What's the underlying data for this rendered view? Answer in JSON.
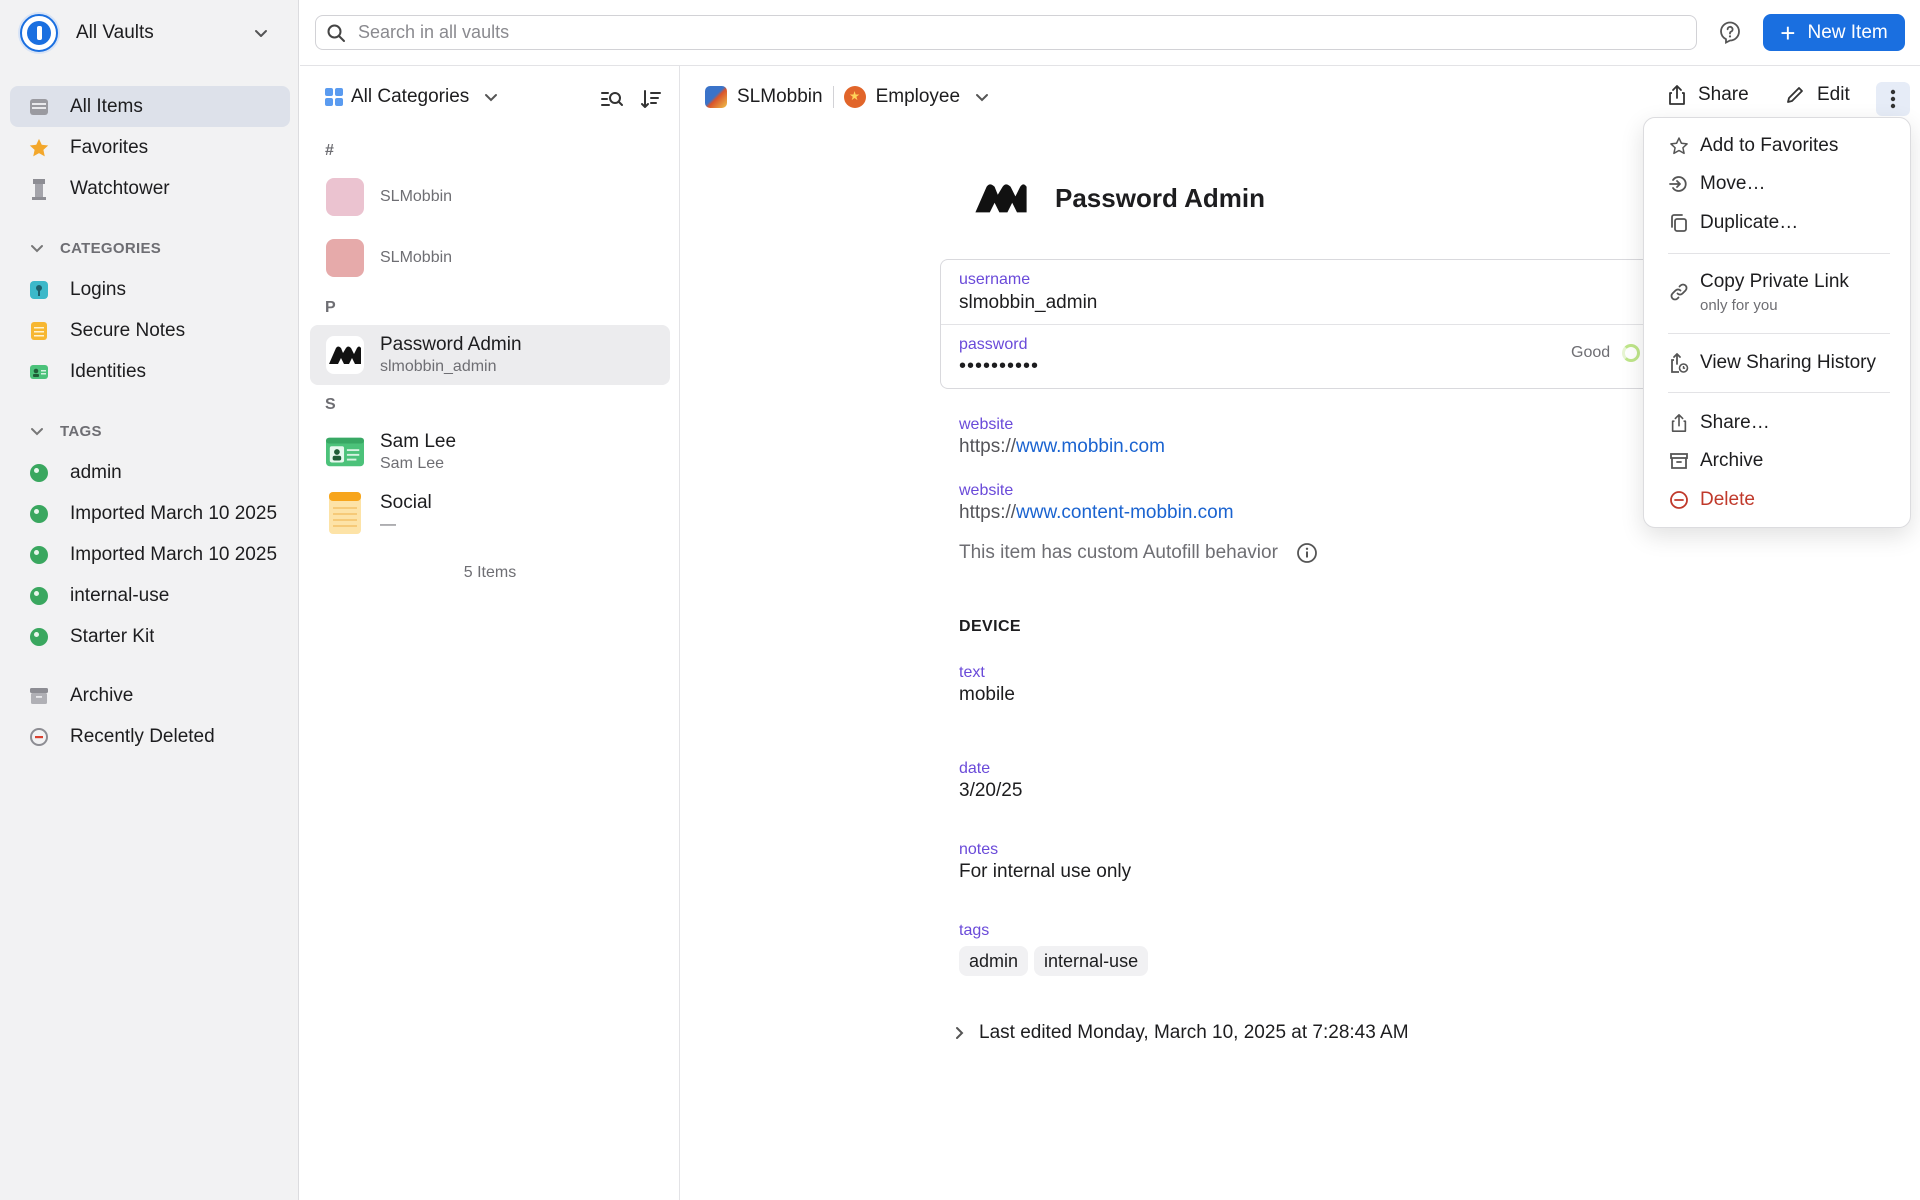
{
  "sidebar": {
    "vault_name": "All Vaults",
    "items": [
      {
        "label": "All Items",
        "icon": "all-items-icon"
      },
      {
        "label": "Favorites",
        "icon": "star-icon"
      },
      {
        "label": "Watchtower",
        "icon": "watchtower-icon"
      }
    ],
    "categories_header": "CATEGORIES",
    "categories": [
      {
        "label": "Logins",
        "icon": "login-icon"
      },
      {
        "label": "Secure Notes",
        "icon": "note-icon"
      },
      {
        "label": "Identities",
        "icon": "identity-icon"
      }
    ],
    "tags_header": "TAGS",
    "tags": [
      {
        "label": "admin"
      },
      {
        "label": "Imported March 10 2025"
      },
      {
        "label": "Imported March 10 2025"
      },
      {
        "label": "internal-use"
      },
      {
        "label": "Starter Kit"
      }
    ],
    "archive": "Archive",
    "recently_deleted": "Recently Deleted"
  },
  "topbar": {
    "search_placeholder": "Search in all vaults",
    "new_item_label": "New Item"
  },
  "list": {
    "category_label": "All Categories",
    "groups": [
      {
        "letter": "#"
      },
      {
        "letter": "P"
      },
      {
        "letter": "S"
      }
    ],
    "items": [
      {
        "title": "SLMobbin",
        "subtitle": "",
        "color": "#ebc3d0"
      },
      {
        "title": "SLMobbin",
        "subtitle": "",
        "color": "#e6aaaa"
      },
      {
        "title": "Password Admin",
        "subtitle": "slmobbin_admin"
      },
      {
        "title": "Sam Lee",
        "subtitle": "Sam Lee"
      },
      {
        "title": "Social",
        "subtitle": "—"
      }
    ],
    "count": "5 Items"
  },
  "detail": {
    "vault": "SLMobbin",
    "owner": "Employee",
    "share_label": "Share",
    "edit_label": "Edit",
    "title": "Password Admin",
    "username_label": "username",
    "username_value": "slmobbin_admin",
    "password_label": "password",
    "password_value": "••••••••••",
    "strength": "Good",
    "website1_label": "website",
    "website1_prefix": "https://",
    "website1_link": "www.mobbin.com",
    "website2_label": "website",
    "website2_prefix": "https://",
    "website2_link": "www.content-mobbin.com",
    "autofill_note": "This item has custom Autofill behavior",
    "section_title": "DEVICE",
    "text_label": "text",
    "text_value": "mobile",
    "date_label": "date",
    "date_value": "3/20/25",
    "notes_label": "notes",
    "notes_value": "For internal use only",
    "tags_label": "tags",
    "tags": [
      "admin",
      "internal-use"
    ],
    "last_edited": "Last edited Monday, March 10, 2025 at 7:28:43 AM"
  },
  "menu": {
    "items": [
      {
        "label": "Add to Favorites",
        "icon": "star-outline-icon"
      },
      {
        "label": "Move…",
        "icon": "move-icon"
      },
      {
        "label": "Duplicate…",
        "icon": "duplicate-icon"
      },
      {
        "label": "Copy Private Link",
        "sub": "only for you",
        "icon": "link-icon"
      },
      {
        "label": "View Sharing History",
        "icon": "sharing-history-icon"
      },
      {
        "label": "Share…",
        "icon": "share-icon"
      },
      {
        "label": "Archive",
        "icon": "archive-icon"
      },
      {
        "label": "Delete",
        "icon": "delete-icon"
      }
    ]
  },
  "colors": {
    "accent": "#1a6fe0",
    "label_purple": "#6a4ad9",
    "link": "#1a63d0",
    "danger": "#c0392b",
    "tag_green": "#3aa75f"
  }
}
